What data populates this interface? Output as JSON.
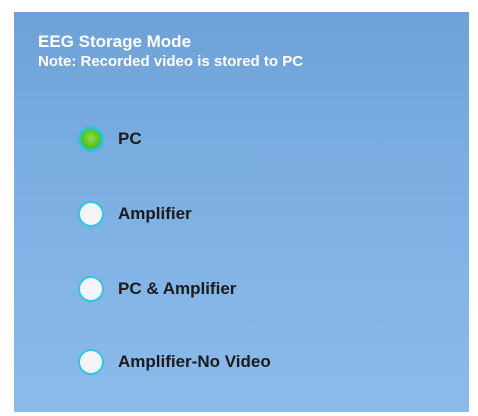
{
  "storage_mode": {
    "title": "EEG Storage Mode",
    "note": "Note: Recorded video is stored to PC",
    "selected": "PC",
    "options": [
      {
        "label": "PC",
        "checked": true
      },
      {
        "label": "Amplifier",
        "checked": false
      },
      {
        "label": "PC & Amplifier",
        "checked": false
      },
      {
        "label": "Amplifier-No Video",
        "checked": false
      }
    ]
  },
  "colors": {
    "panel_background": "#78abdf",
    "text_header": "#ffffff",
    "text_option": "#1b1b1b",
    "radio_border": "#2ec9dc",
    "radio_checked_fill": "#5cc12a",
    "radio_unchecked_fill": "#f4f4f6"
  }
}
